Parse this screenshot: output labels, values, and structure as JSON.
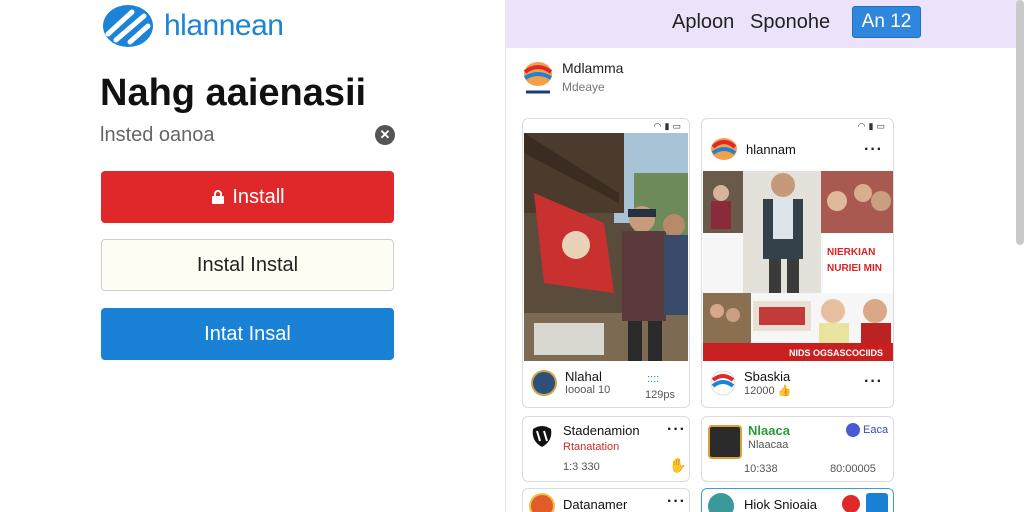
{
  "left": {
    "brand_name": "hlannean",
    "heading": "Nahg aaienasii",
    "field_placeholder": "lnsted oanoa",
    "buttons": {
      "primary_label": "Install",
      "secondary_label": "Instal Instal",
      "tertiary_label": "Intat Insal"
    }
  },
  "right": {
    "topbar": {
      "link1": "Aploon",
      "link2": "Sponohe",
      "button_label": "An 12"
    },
    "profile": {
      "name": "Mdlamma",
      "sub": "Mdeaye"
    },
    "card_photo": {
      "footer_name": "Nlahal",
      "footer_meta": "Ioooal 10",
      "footer_meta_right": "129ps",
      "link_label": "::::"
    },
    "card_collage": {
      "header_name": "hlannam",
      "collage_text": "NIERKIAN\nNURIEI MIN",
      "banner_text": "NIDS OGSASCOCIIDS",
      "footer_name": "Sbaskia",
      "footer_meta": "12000 👍"
    },
    "card_row1_left": {
      "name": "Stadenamion",
      "sub": "Rtanatation",
      "meta": "1:3 330"
    },
    "card_row1_right": {
      "name": "Nlaaca",
      "sub": "Nlaacaa",
      "meta_left": "10:338",
      "meta_right": "80:00005",
      "badge": "Eaca"
    },
    "card_row2_left": {
      "name": "Datanamer"
    },
    "card_row2_right": {
      "name": "Hiok Snioaia"
    },
    "colors": {
      "accent_blue": "#1a82d6",
      "accent_red": "#e0282a",
      "topbar_bg": "#ece2fa"
    }
  }
}
